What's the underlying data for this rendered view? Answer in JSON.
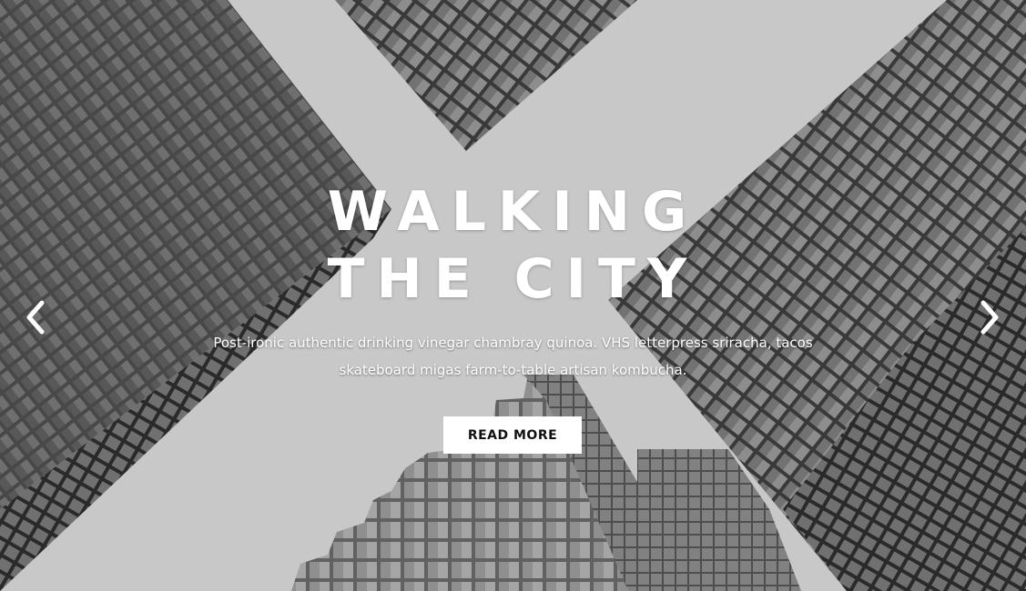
{
  "slide": {
    "title_line1": "WALKING",
    "title_line2": "THE CITY",
    "description": "Post-ironic authentic drinking vinegar chambray quinoa. VHS letterpress sriracha, tacos skateboard migas farm-to-table artisan kombucha.",
    "button_label": "READ MORE"
  },
  "controls": {
    "prev_icon": "chevron-left-icon",
    "next_icon": "chevron-right-icon"
  },
  "colors": {
    "text": "#ffffff",
    "button_bg": "#ffffff",
    "button_text": "#111111"
  }
}
